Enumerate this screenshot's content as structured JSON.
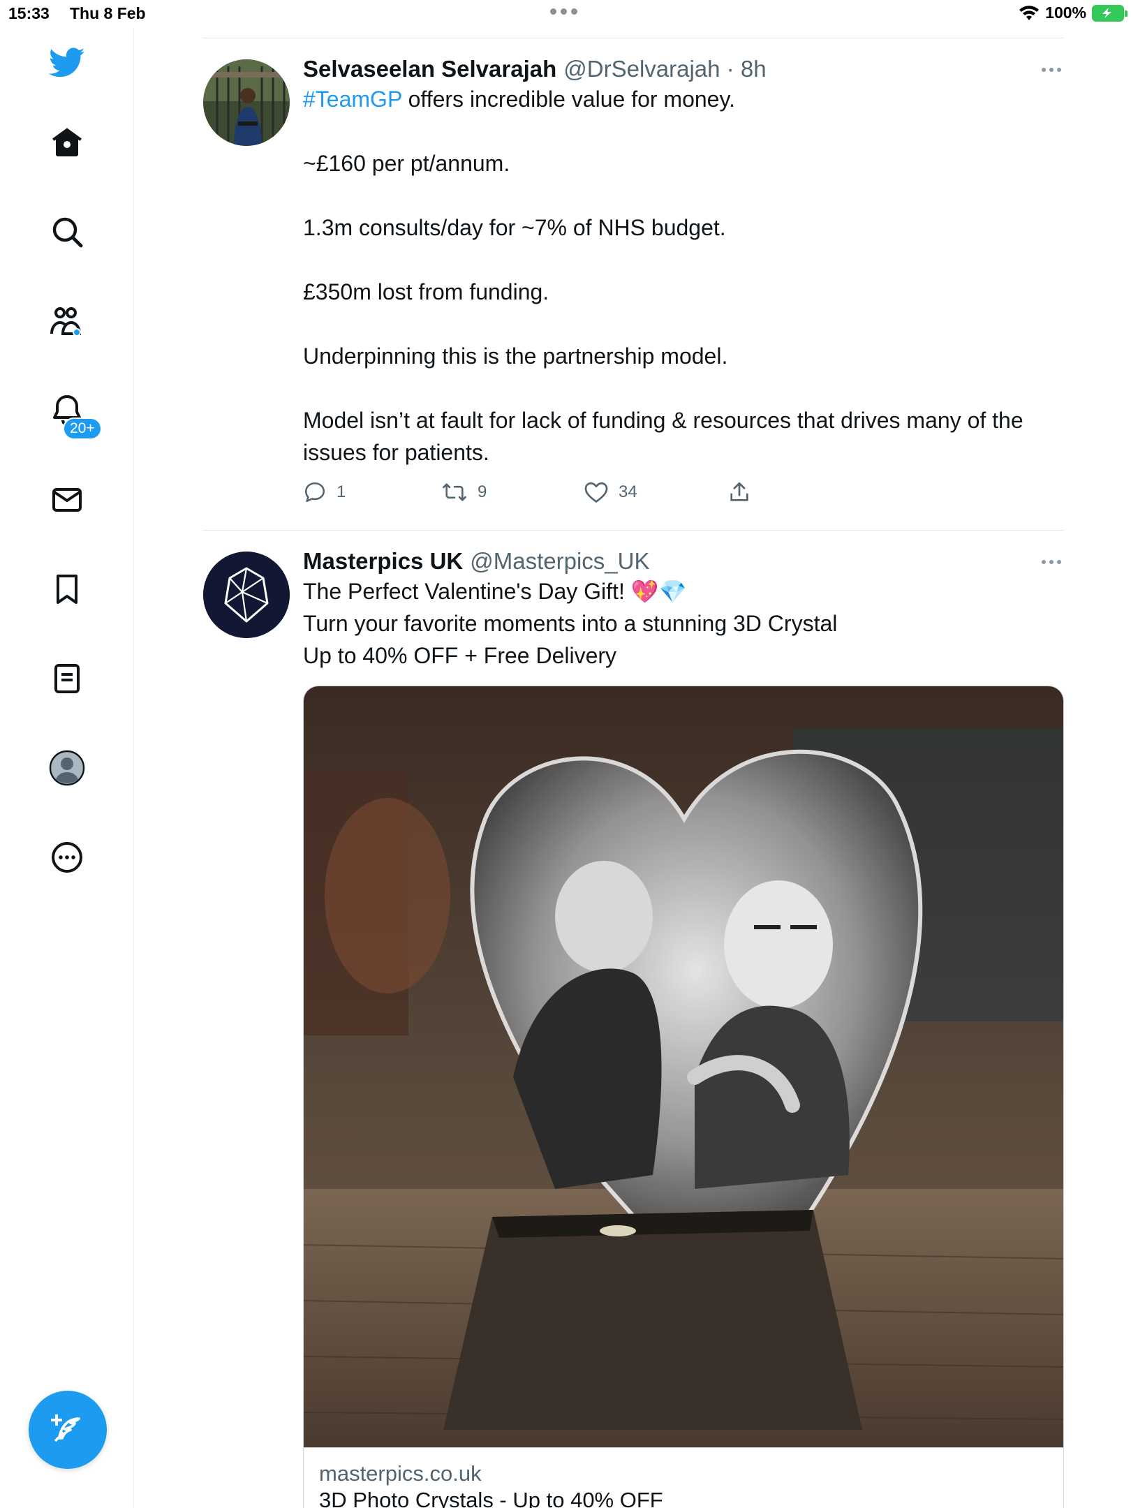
{
  "status_bar": {
    "time": "15:33",
    "date": "Thu 8 Feb",
    "battery_label": "100%"
  },
  "sidebar": {
    "items": [
      {
        "name": "home"
      },
      {
        "name": "explore"
      },
      {
        "name": "communities"
      },
      {
        "name": "notifications",
        "badge": "20+"
      },
      {
        "name": "messages"
      },
      {
        "name": "bookmarks"
      },
      {
        "name": "lists"
      },
      {
        "name": "profile"
      },
      {
        "name": "more"
      }
    ],
    "compose_icon": "feather-plus-icon",
    "accent_color": "#1d9bf0"
  },
  "tweets": [
    {
      "name": "Selvaseelan Selvarajah",
      "handle_time": "@DrSelvarajah · 8h",
      "hashtag": "#TeamGP",
      "first_line_rest": " offers incredible value for money.",
      "paragraphs": [
        "~£160 per pt/annum.",
        " 1.3m consults/day for ~7% of NHS budget.",
        "£350m lost from funding.",
        "Underpinning this is the partnership model.",
        "Model isn’t at fault for lack of funding & resources that drives many of the issues for patients."
      ],
      "replies": "1",
      "retweets": "9",
      "likes": "34"
    },
    {
      "name": "Masterpics UK",
      "handle_time": "@Masterpics_UK",
      "lines": [
        "The Perfect Valentine's Day Gift! 💖💎",
        "Turn your favorite moments into a stunning 3D Crystal",
        "Up to 40% OFF + Free Delivery"
      ],
      "card": {
        "domain": "masterpics.co.uk",
        "title": "3D Photo Crystals - Up to 40% OFF"
      }
    }
  ]
}
